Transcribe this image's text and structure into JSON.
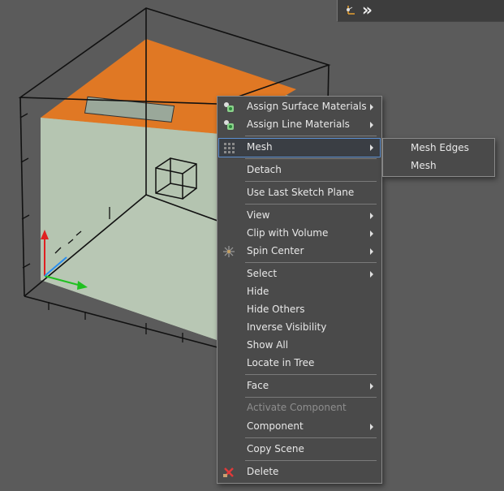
{
  "toolbar": {
    "icons": [
      "axes-icon",
      "double-chevron-right-icon"
    ],
    "more_label": "»"
  },
  "context_menu": {
    "items": {
      "assign_surface_materials": "Assign Surface Materials",
      "assign_line_materials": "Assign Line Materials",
      "mesh": "Mesh",
      "detach": "Detach",
      "use_last_sketch_plane": "Use Last Sketch Plane",
      "view": "View",
      "clip_with_volume": "Clip with Volume",
      "spin_center": "Spin Center",
      "select": "Select",
      "hide": "Hide",
      "hide_others": "Hide Others",
      "inverse_visibility": "Inverse Visibility",
      "show_all": "Show All",
      "locate_in_tree": "Locate in Tree",
      "face": "Face",
      "activate_component": "Activate Component",
      "component": "Component",
      "copy_scene": "Copy Scene",
      "delete": "Delete"
    }
  },
  "submenu": {
    "items": {
      "mesh_edges": "Mesh Edges",
      "mesh": "Mesh"
    }
  },
  "colors": {
    "viewport_bg": "#5b5b5b",
    "menu_bg": "#4a4a4a",
    "highlight_border": "#5c8fd1",
    "box_top": "#e07824",
    "box_faces": "#b8c8b4"
  }
}
